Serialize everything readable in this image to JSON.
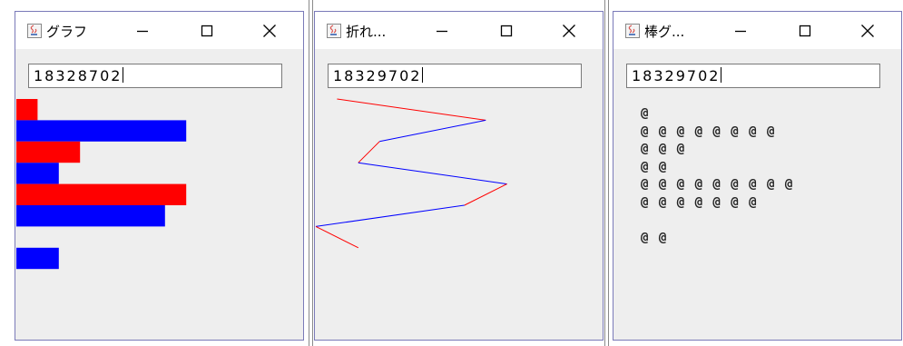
{
  "windows": [
    {
      "title": "グラフ",
      "input_value": "18328702",
      "chart_data": {
        "type": "bar",
        "orientation": "horizontal",
        "values": [
          1,
          8,
          3,
          2,
          8,
          7,
          0,
          2
        ],
        "colors": [
          "#ff0000",
          "#0000ff"
        ]
      }
    },
    {
      "title": "折れ...",
      "input_value": "18329702",
      "chart_data": {
        "type": "line",
        "values": [
          1,
          8,
          3,
          2,
          9,
          7,
          0,
          2
        ],
        "colors": [
          "#ff0000",
          "#0000ff"
        ]
      }
    },
    {
      "title": "棒グ...",
      "input_value": "18329702",
      "bar_char": "@",
      "values": [
        1,
        8,
        3,
        2,
        9,
        7,
        0,
        2
      ]
    }
  ],
  "icons": {
    "app": "java-cup-icon",
    "minimize": "minimize-icon",
    "maximize": "maximize-icon",
    "close": "close-icon"
  }
}
